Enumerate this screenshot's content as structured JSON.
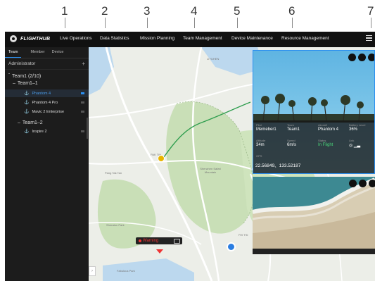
{
  "callouts": [
    "1",
    "2",
    "3",
    "4",
    "5",
    "6",
    "7"
  ],
  "app": {
    "logo": "FLIGHTHUB"
  },
  "nav": [
    "Live Operations",
    "Data Statistics",
    "Mission Planning",
    "Team Management",
    "Device Maintenance",
    "Resource Management"
  ],
  "sidebar": {
    "tabs": [
      "Team",
      "Member",
      "Device"
    ],
    "role": "Administrator",
    "add_symbol": "+",
    "team_root": {
      "label": "Team1 (2/10)"
    },
    "groups": [
      {
        "label": "Team1–1",
        "devices": [
          {
            "name": "Phantom 4",
            "selected": true
          },
          {
            "name": "Phantom 4 Pro"
          },
          {
            "name": "Mavic 2 Enterprise"
          }
        ]
      },
      {
        "label": "Team1–2",
        "devices": [
          {
            "name": "Inspire 2"
          }
        ]
      }
    ]
  },
  "map": {
    "places": [
      "LIYUHEN",
      "PAK TIN",
      "Pang Tak Tan",
      "Shenzhen Safari Mountain",
      "Sheraton Park",
      "FEI TSI",
      "Fabulous Park"
    ],
    "popup": {
      "label": "Warning"
    },
    "colors": {
      "park": "#c9dfb7",
      "water": "#bcd8ee",
      "road": "#ffffff",
      "route": "#2f9e4f"
    }
  },
  "cam1": {
    "fields": [
      {
        "label": "Pilot",
        "value": "Memeber1"
      },
      {
        "label": "Team",
        "value": "Team1"
      },
      {
        "label": "Aircraft",
        "value": "Phantom 4"
      },
      {
        "label": "Battery Level",
        "value": "36%"
      },
      {
        "label": "Altitude",
        "value": "34m"
      },
      {
        "label": "Speed",
        "value": "6m/s"
      },
      {
        "label": "Status",
        "value": "In Flight",
        "color": "#49d67a"
      },
      {
        "label": "Link",
        "value": "◎ ▁▃"
      }
    ],
    "gps_label": "GPS",
    "coords": "22.56849、133.52187"
  }
}
